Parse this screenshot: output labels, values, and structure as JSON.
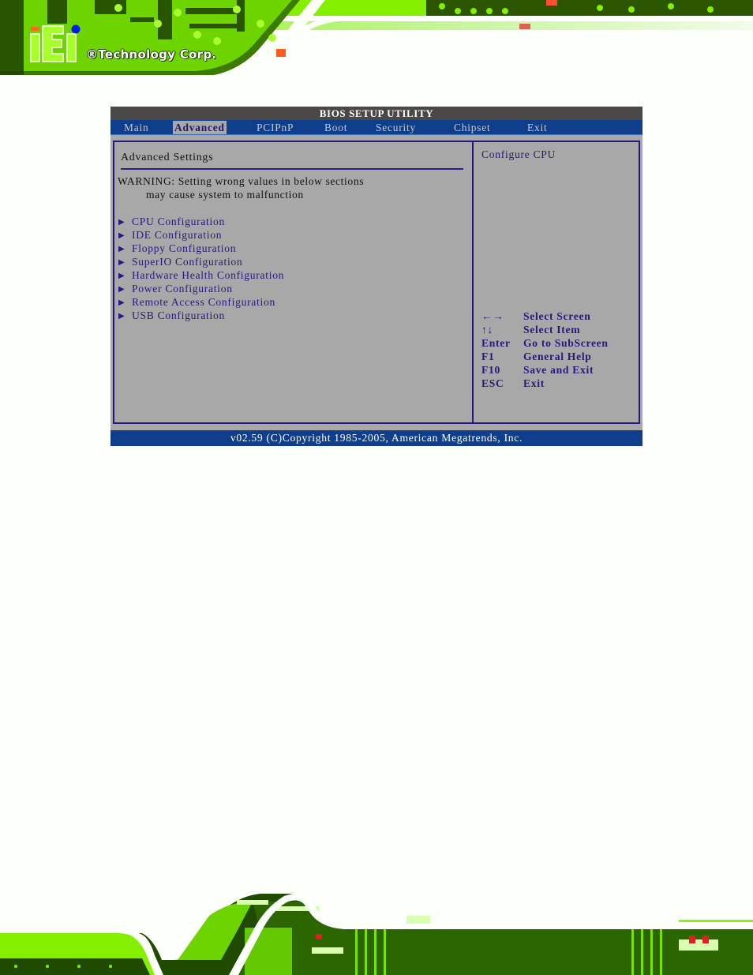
{
  "branding": {
    "logo_text": "iEi",
    "tagline": "®Technology Corp.",
    "colors": {
      "green": "#84f000",
      "dark_green": "#1c3a00",
      "logo_dot": "#0020e0",
      "logo_bar": "#ff6a1a"
    }
  },
  "bios": {
    "title": "BIOS SETUP UTILITY",
    "tabs": [
      {
        "label": "Main",
        "active": false
      },
      {
        "label": "Advanced",
        "active": true
      },
      {
        "label": "PCIPnP",
        "active": false
      },
      {
        "label": "Boot",
        "active": false
      },
      {
        "label": "Security",
        "active": false
      },
      {
        "label": "Chipset",
        "active": false
      },
      {
        "label": "Exit",
        "active": false
      }
    ],
    "main_panel": {
      "section_title": "Advanced Settings",
      "warning_line1": "WARNING: Setting wrong values in below sections",
      "warning_line2": "         may cause system to malfunction",
      "items": [
        {
          "marker": "▶",
          "label": "CPU Configuration"
        },
        {
          "marker": "▶",
          "label": "IDE Configuration"
        },
        {
          "marker": "▶",
          "label": "Floppy Configuration"
        },
        {
          "marker": "▶",
          "label": "SuperIO Configuration"
        },
        {
          "marker": "▶",
          "label": "Hardware Health Configuration"
        },
        {
          "marker": "▶",
          "label": "Power Configuration"
        },
        {
          "marker": "▶",
          "label": "Remote Access Configuration"
        },
        {
          "marker": "▶",
          "label": "USB Configuration"
        }
      ]
    },
    "help_panel": {
      "description": "Configure CPU",
      "keys": [
        {
          "key": "←→",
          "action": "Select Screen"
        },
        {
          "key": "↑↓",
          "action": "Select Item"
        },
        {
          "key": "Enter",
          "action": "Go to SubScreen"
        },
        {
          "key": "F1",
          "action": "General Help"
        },
        {
          "key": "F10",
          "action": "Save and Exit"
        },
        {
          "key": "ESC",
          "action": "Exit"
        }
      ]
    },
    "status_bar": "v02.59 (C)Copyright 1985-2005, American Megatrends, Inc.",
    "colors": {
      "title_bar": "#4a4846",
      "menu_bar": "#0f3f8c",
      "panel_bg": "#a8a8a8",
      "border": "#24177a",
      "item_text": "#25197c"
    }
  }
}
